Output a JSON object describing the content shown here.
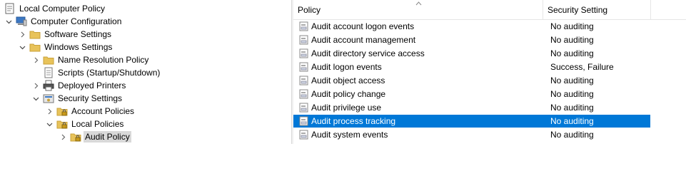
{
  "tree": {
    "items": [
      {
        "label": "Local Computer Policy",
        "icon": "policy-doc-icon",
        "chevron": ""
      },
      {
        "label": "Computer Configuration",
        "icon": "computer-icon",
        "chevron": "down"
      },
      {
        "label": "Software Settings",
        "icon": "folder-icon",
        "chevron": "right"
      },
      {
        "label": "Windows Settings",
        "icon": "folder-icon",
        "chevron": "down"
      },
      {
        "label": "Name Resolution Policy",
        "icon": "folder-icon",
        "chevron": "right"
      },
      {
        "label": "Scripts (Startup/Shutdown)",
        "icon": "script-icon",
        "chevron": ""
      },
      {
        "label": "Deployed Printers",
        "icon": "printer-icon",
        "chevron": "right"
      },
      {
        "label": "Security Settings",
        "icon": "security-icon",
        "chevron": "down"
      },
      {
        "label": "Account Policies",
        "icon": "secure-folder-icon",
        "chevron": "right"
      },
      {
        "label": "Local Policies",
        "icon": "secure-folder-icon",
        "chevron": "down"
      },
      {
        "label": "Audit Policy",
        "icon": "secure-folder-icon",
        "chevron": "right"
      }
    ]
  },
  "list": {
    "columns": {
      "policy": "Policy",
      "setting": "Security Setting"
    },
    "rows": [
      {
        "policy": "Audit account logon events",
        "setting": "No auditing"
      },
      {
        "policy": "Audit account management",
        "setting": "No auditing"
      },
      {
        "policy": "Audit directory service access",
        "setting": "No auditing"
      },
      {
        "policy": "Audit logon events",
        "setting": "Success, Failure"
      },
      {
        "policy": "Audit object access",
        "setting": "No auditing"
      },
      {
        "policy": "Audit policy change",
        "setting": "No auditing"
      },
      {
        "policy": "Audit privilege use",
        "setting": "No auditing"
      },
      {
        "policy": "Audit process tracking",
        "setting": "No auditing"
      },
      {
        "policy": "Audit system events",
        "setting": "No auditing"
      }
    ]
  },
  "colors": {
    "selection": "#0078d7",
    "tree_selection": "#d9d9d9",
    "folder": "#e8c35a"
  }
}
